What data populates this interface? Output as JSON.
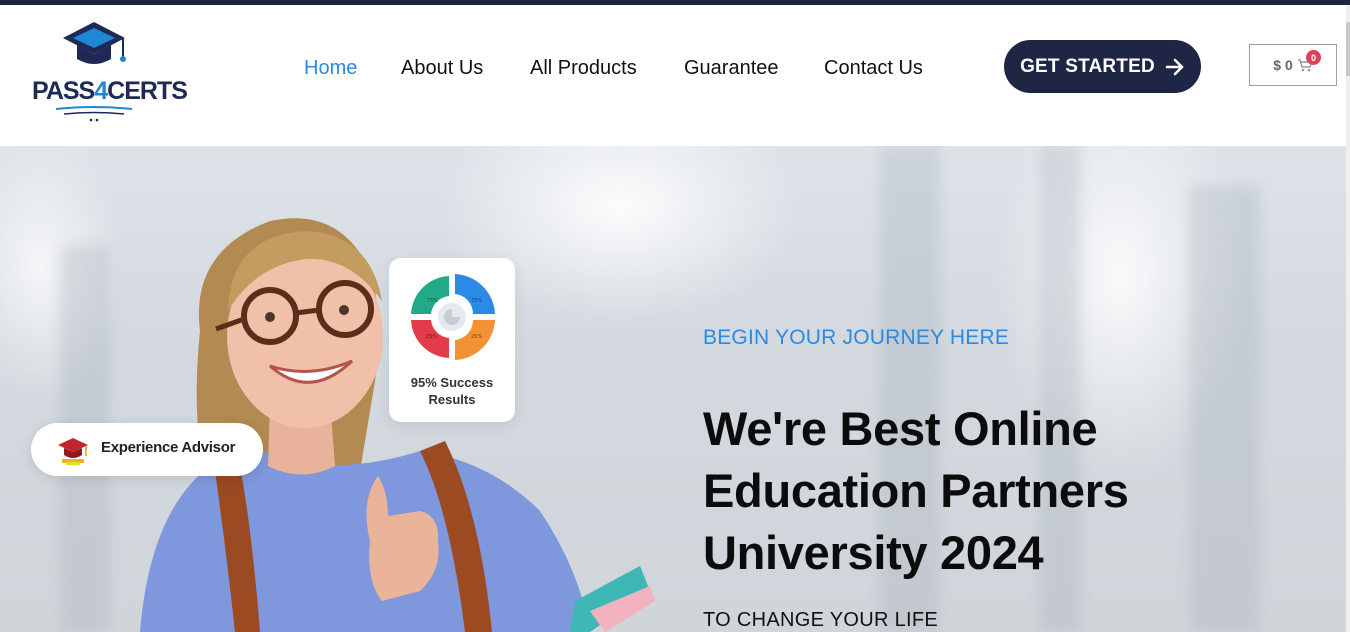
{
  "logo": {
    "text_part1": "PASS",
    "text_four": "4",
    "text_part2": "CERTS"
  },
  "nav": {
    "items": [
      {
        "label": "Home",
        "active": true
      },
      {
        "label": "About Us",
        "active": false
      },
      {
        "label": "All Products",
        "active": false
      },
      {
        "label": "Guarantee",
        "active": false
      },
      {
        "label": "Contact Us",
        "active": false
      }
    ]
  },
  "cta": {
    "label": "GET STARTED",
    "icon": "arrow-right-icon"
  },
  "cart": {
    "amount": "$ 0",
    "count": "0",
    "icon": "cart-icon"
  },
  "hero": {
    "stat_card": {
      "label": "95% Success Results",
      "line1": "95% Success",
      "line2": "Results",
      "chart_labels": [
        "75%",
        "75%",
        "25%",
        "25%"
      ],
      "colors": [
        "#22aa88",
        "#2b8ae6",
        "#e23b4a",
        "#f39234"
      ]
    },
    "advisor": {
      "label": "Experience Advisor",
      "icon": "graduation-cap-icon"
    },
    "tagline": "BEGIN YOUR JOURNEY HERE",
    "headline_line1": "We're Best Online",
    "headline_line2": "Education Partners",
    "headline_line3": "University 2024",
    "subline": "TO CHANGE YOUR LIFE"
  },
  "colors": {
    "navy": "#1f2544",
    "accent_blue": "#2b8ae6",
    "badge_red": "#e0405a"
  }
}
